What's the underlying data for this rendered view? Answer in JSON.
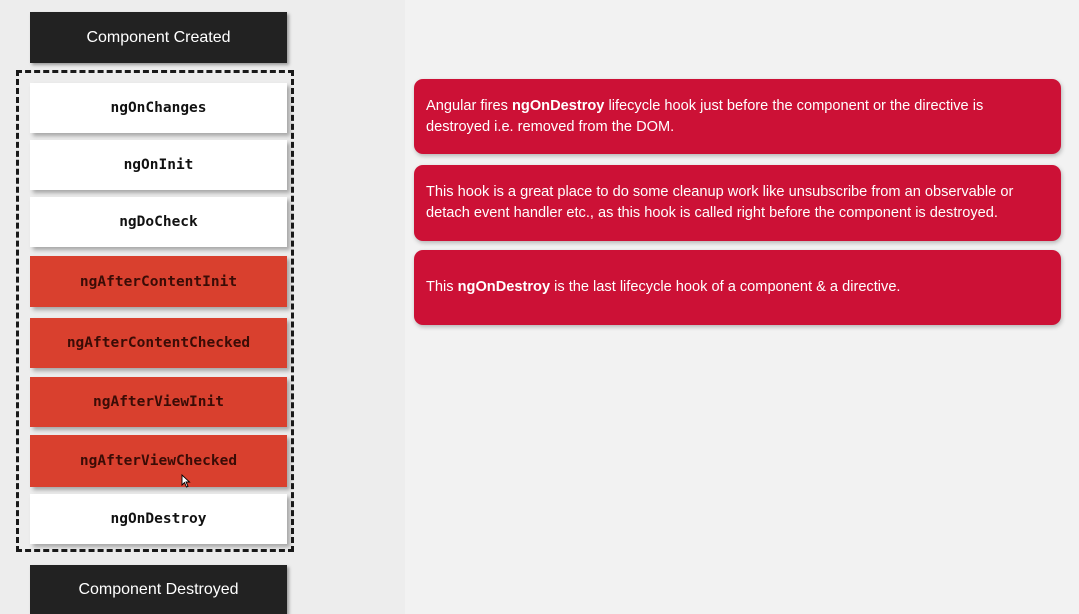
{
  "diagram": {
    "start_label": "Component Created",
    "end_label": "Component Destroyed",
    "hooks": [
      {
        "label": "ngOnChanges",
        "style": "white"
      },
      {
        "label": "ngOnInit",
        "style": "white"
      },
      {
        "label": "ngDoCheck",
        "style": "white"
      },
      {
        "label": "ngAfterContentInit",
        "style": "red"
      },
      {
        "label": "ngAfterContentChecked",
        "style": "red"
      },
      {
        "label": "ngAfterViewInit",
        "style": "red"
      },
      {
        "label": "ngAfterViewChecked",
        "style": "red"
      },
      {
        "label": "ngOnDestroy",
        "style": "white"
      }
    ]
  },
  "cards": [
    {
      "before": "Angular fires ",
      "bold": "ngOnDestroy",
      "after": " lifecycle hook just before the component or the directive is destroyed i.e. removed from the DOM."
    },
    {
      "text": "This hook is a great place to do some cleanup work like unsubscribe from an observable or detach event handler etc., as this hook is called right before the component is destroyed."
    },
    {
      "before": "This ",
      "bold": "ngOnDestroy",
      "after": " is the last lifecycle hook of a component & a directive."
    }
  ],
  "colors": {
    "dark_box": "#222222",
    "hook_white": "#ffffff",
    "hook_red": "#d9402e",
    "card_red": "#cc1136",
    "background": "#f2f2f2"
  }
}
